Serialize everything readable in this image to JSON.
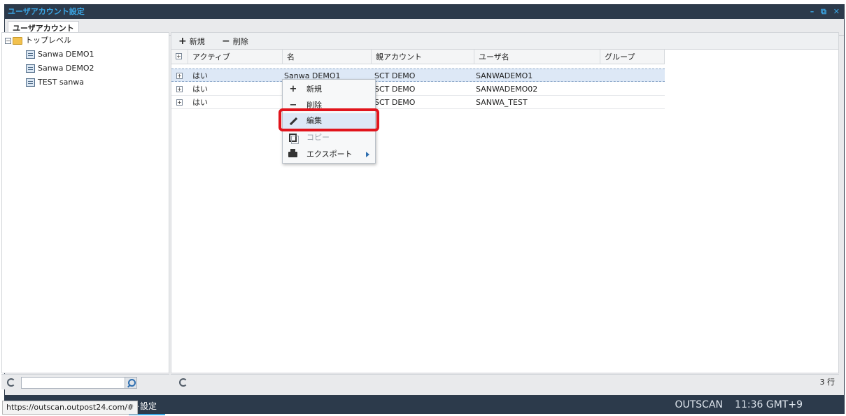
{
  "window": {
    "title": "ユーザアカウント設定",
    "controls": {
      "minimize": "–",
      "restore": "⧉",
      "close": "✕"
    }
  },
  "tabs": [
    {
      "label": "ユーザアカウント"
    }
  ],
  "tree": {
    "root": "トップレベル",
    "items": [
      "Sanwa DEMO1",
      "Sanwa DEMO2",
      "TEST sanwa"
    ]
  },
  "toolbar": {
    "new_label": "新規",
    "delete_label": "削除"
  },
  "grid": {
    "columns": [
      "アクティブ",
      "名",
      "親アカウント",
      "ユーザ名",
      "グループ"
    ],
    "rows": [
      {
        "active": "はい",
        "name": "Sanwa DEMO1",
        "parent": "SCT DEMO",
        "username": "SANWADEMO1",
        "group": ""
      },
      {
        "active": "はい",
        "name": "",
        "parent": "SCT DEMO",
        "username": "SANWADEMO02",
        "group": ""
      },
      {
        "active": "はい",
        "name": "",
        "parent": "SCT DEMO",
        "username": "SANWA_TEST",
        "group": ""
      }
    ],
    "row_count": "3 行"
  },
  "context_menu": {
    "items": [
      {
        "label": "新規",
        "icon": "plus-icon"
      },
      {
        "label": "削除",
        "icon": "minus-icon"
      },
      {
        "label": "編集",
        "icon": "pencil-icon"
      },
      {
        "label": "コピー",
        "icon": "copy-icon"
      },
      {
        "label": "エクスポート",
        "icon": "printer-icon"
      }
    ]
  },
  "taskbar": {
    "task_label": "ト設定",
    "brand": "OUTSCAN",
    "clock": "11:36 GMT+9"
  },
  "status_url": "https://outscan.outpost24.com/#",
  "colors": {
    "titlebar": "#2c3a4b",
    "accent": "#3ba7e6",
    "highlight": "#e1141c",
    "selection": "#dde8f6"
  }
}
